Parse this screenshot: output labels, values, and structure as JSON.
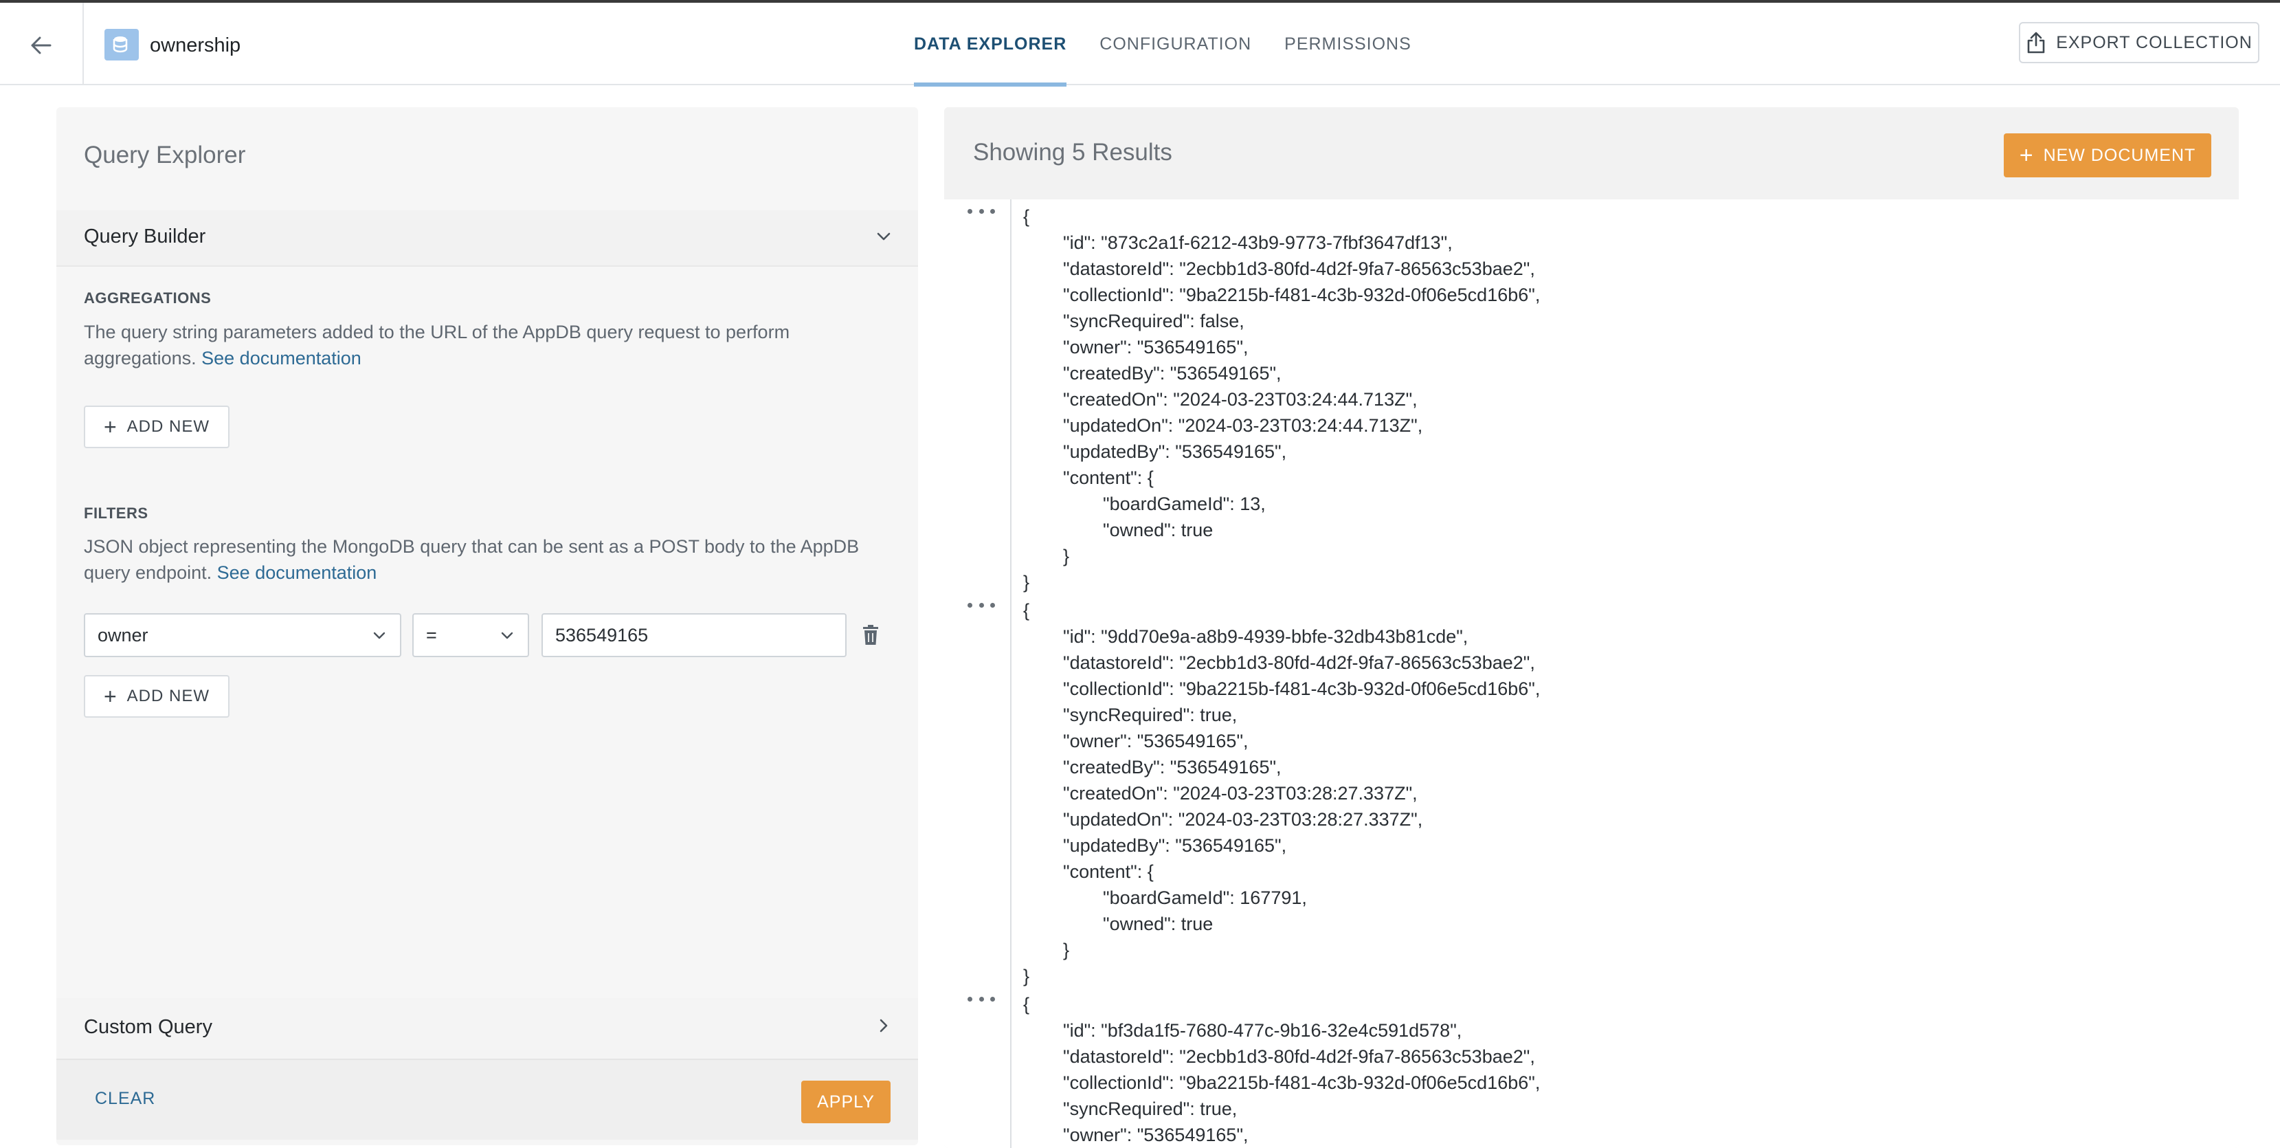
{
  "header": {
    "collection_name": "ownership",
    "tabs": [
      {
        "label": "DATA EXPLORER",
        "active": true
      },
      {
        "label": "CONFIGURATION",
        "active": false
      },
      {
        "label": "PERMISSIONS",
        "active": false
      }
    ],
    "export_label": "EXPORT COLLECTION"
  },
  "query_explorer": {
    "title": "Query Explorer",
    "query_builder_label": "Query Builder",
    "aggregations": {
      "title": "AGGREGATIONS",
      "description": "The query string parameters added to the URL of the AppDB query request to perform aggregations.",
      "link": "See documentation",
      "add_new_label": "ADD NEW"
    },
    "filters": {
      "title": "FILTERS",
      "description": "JSON object representing the MongoDB query that can be sent as a POST body to the AppDB query endpoint.",
      "link": "See documentation",
      "field_value": "owner",
      "operator_value": "=",
      "filter_value": "536549165",
      "add_new_label": "ADD NEW"
    },
    "custom_query_label": "Custom Query",
    "clear_label": "CLEAR",
    "apply_label": "APPLY"
  },
  "results": {
    "title": "Showing 5 Results",
    "new_document_label": "NEW DOCUMENT",
    "documents": [
      {
        "lines": [
          "{",
          "\"id\": \"873c2a1f-6212-43b9-9773-7fbf3647df13\",",
          "\"datastoreId\": \"2ecbb1d3-80fd-4d2f-9fa7-86563c53bae2\",",
          "\"collectionId\": \"9ba2215b-f481-4c3b-932d-0f06e5cd16b6\",",
          "\"syncRequired\": false,",
          "\"owner\": \"536549165\",",
          "\"createdBy\": \"536549165\",",
          "\"createdOn\": \"2024-03-23T03:24:44.713Z\",",
          "\"updatedOn\": \"2024-03-23T03:24:44.713Z\",",
          "\"updatedBy\": \"536549165\",",
          "\"content\": {",
          "\"boardGameId\": 13,",
          "\"owned\": true",
          "}",
          "}"
        ]
      },
      {
        "lines": [
          "{",
          "\"id\": \"9dd70e9a-a8b9-4939-bbfe-32db43b81cde\",",
          "\"datastoreId\": \"2ecbb1d3-80fd-4d2f-9fa7-86563c53bae2\",",
          "\"collectionId\": \"9ba2215b-f481-4c3b-932d-0f06e5cd16b6\",",
          "\"syncRequired\": true,",
          "\"owner\": \"536549165\",",
          "\"createdBy\": \"536549165\",",
          "\"createdOn\": \"2024-03-23T03:28:27.337Z\",",
          "\"updatedOn\": \"2024-03-23T03:28:27.337Z\",",
          "\"updatedBy\": \"536549165\",",
          "\"content\": {",
          "\"boardGameId\": 167791,",
          "\"owned\": true",
          "}",
          "}"
        ]
      },
      {
        "lines": [
          "{",
          "\"id\": \"bf3da1f5-7680-477c-9b16-32e4c591d578\",",
          "\"datastoreId\": \"2ecbb1d3-80fd-4d2f-9fa7-86563c53bae2\",",
          "\"collectionId\": \"9ba2215b-f481-4c3b-932d-0f06e5cd16b6\",",
          "\"syncRequired\": true,",
          "\"owner\": \"536549165\","
        ]
      }
    ]
  }
}
